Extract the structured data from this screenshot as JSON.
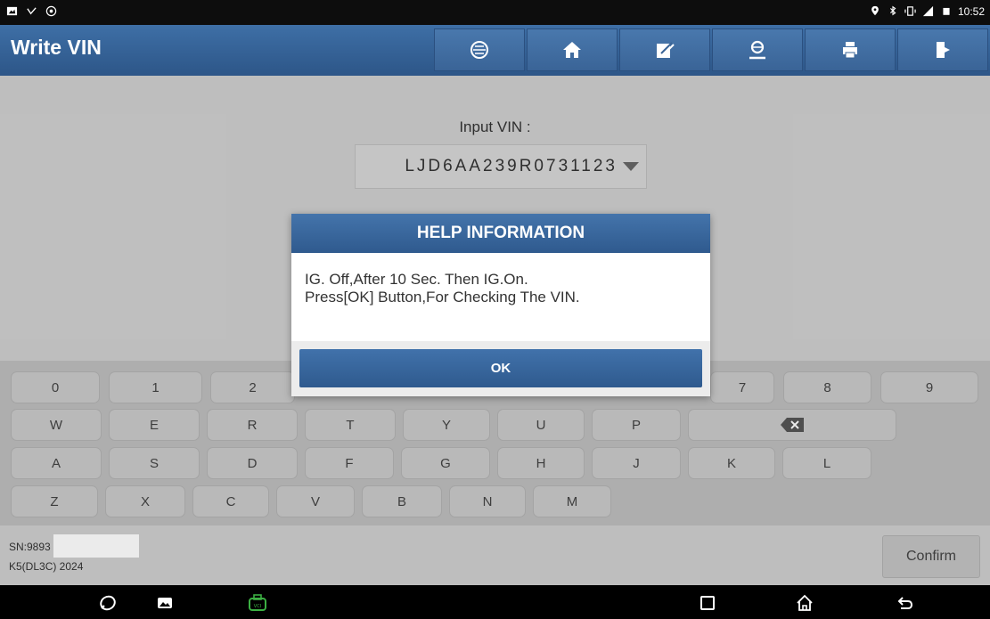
{
  "status_bar": {
    "left_icons": [
      "image-icon",
      "usb-debug-icon",
      "settings-icon"
    ],
    "right_icons": [
      "location-icon",
      "bluetooth-icon",
      "vibrate-icon",
      "signal-icon",
      "battery-icon"
    ],
    "time": "10:52"
  },
  "header": {
    "title": "Write VIN",
    "tools": [
      "diagnose-icon",
      "home-icon",
      "edit-icon",
      "feedback-icon",
      "print-icon",
      "exit-icon"
    ]
  },
  "main": {
    "vin_label": "Input VIN :",
    "vin_value": "LJD6AA239R0731123"
  },
  "keyboard": {
    "row1": [
      "0",
      "1",
      "2",
      "",
      "",
      "",
      "",
      "7",
      "8",
      "9"
    ],
    "row2": [
      "W",
      "E",
      "R",
      "T",
      "Y",
      "U",
      "P"
    ],
    "row3": [
      "A",
      "S",
      "D",
      "F",
      "G",
      "H",
      "J",
      "K",
      "L"
    ],
    "row4": [
      "Z",
      "X",
      "C",
      "V",
      "B",
      "N",
      "M"
    ]
  },
  "footer": {
    "sn": "SN:9893",
    "model": "K5(DL3C) 2024",
    "confirm_label": "Confirm"
  },
  "dialog": {
    "title": "HELP INFORMATION",
    "line1": "IG. Off,After 10 Sec. Then IG.On.",
    "line2": "Press[OK] Button,For Checking The VIN.",
    "ok_label": "OK"
  },
  "nav_bar": {
    "icons": [
      "browser-icon",
      "gallery-icon",
      "vci-icon",
      "recent-apps-icon",
      "home-icon",
      "back-icon"
    ],
    "vci_color": "#3cb043"
  }
}
